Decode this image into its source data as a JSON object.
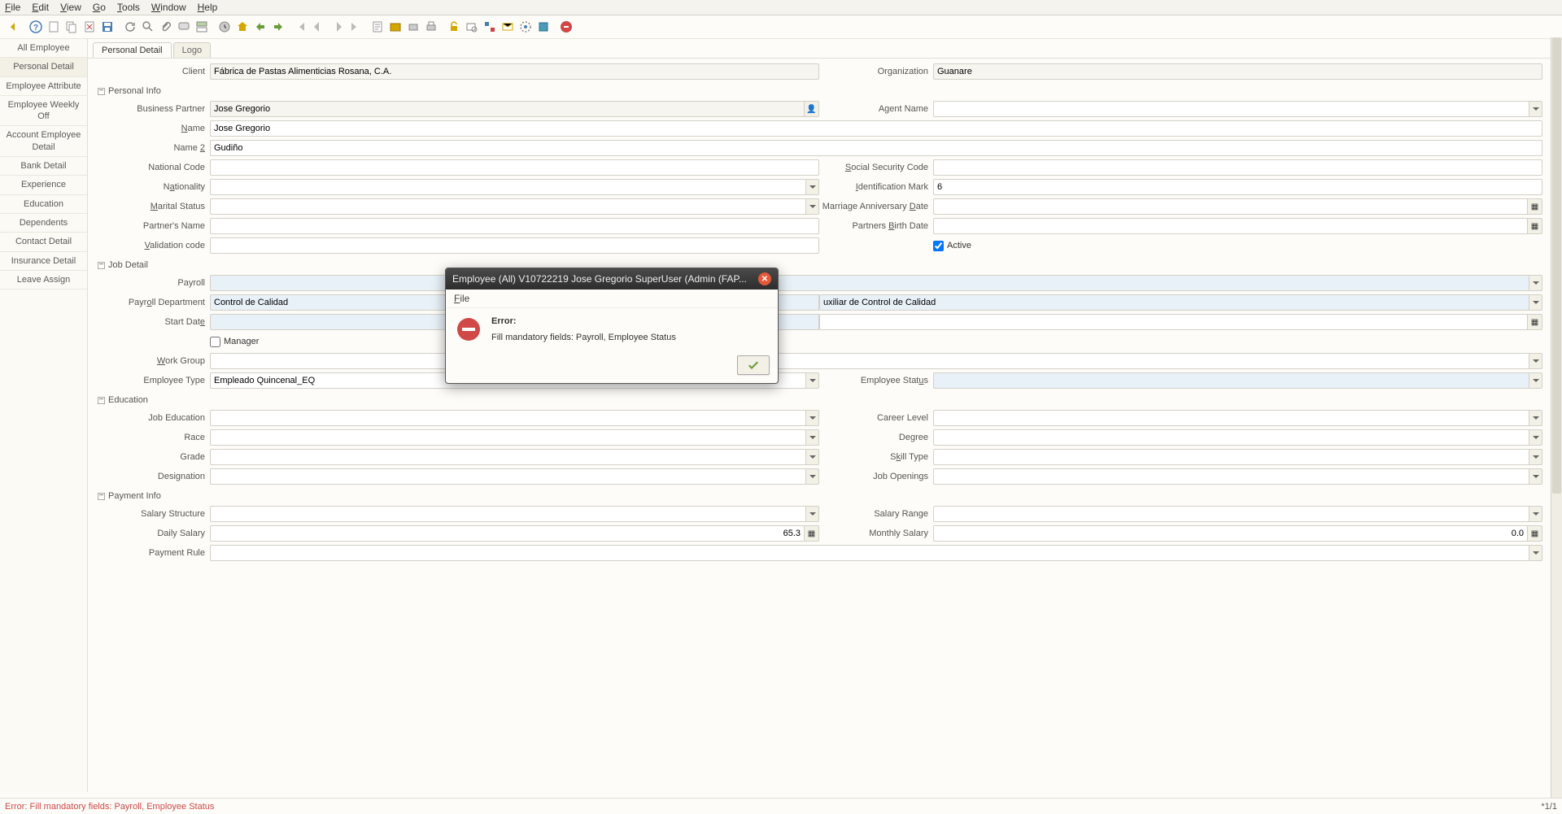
{
  "menu": {
    "file": "File",
    "edit": "Edit",
    "view": "View",
    "go": "Go",
    "tools": "Tools",
    "window": "Window",
    "help": "Help"
  },
  "sidebar": {
    "items": [
      {
        "label": "All Employee"
      },
      {
        "label": "Personal Detail"
      },
      {
        "label": "Employee Attribute"
      },
      {
        "label": "Employee Weekly Off"
      },
      {
        "label": "Account Employee Detail"
      },
      {
        "label": "Bank Detail"
      },
      {
        "label": "Experience"
      },
      {
        "label": "Education"
      },
      {
        "label": "Dependents"
      },
      {
        "label": "Contact Detail"
      },
      {
        "label": "Insurance Detail"
      },
      {
        "label": "Leave Assign"
      }
    ]
  },
  "tabs": {
    "personal": "Personal Detail",
    "logo": "Logo"
  },
  "top_row": {
    "client_lbl": "Client",
    "client_val": "Fábrica de Pastas Alimenticias Rosana, C.A.",
    "org_lbl": "Organization",
    "org_val": "Guanare"
  },
  "sections": {
    "personal": "Personal Info",
    "job": "Job Detail",
    "edu": "Education",
    "pay": "Payment Info"
  },
  "personal": {
    "bp_lbl": "Business Partner",
    "bp_val": "Jose Gregorio",
    "agent_lbl": "Agent Name",
    "agent_val": "",
    "name_lbl": "Name",
    "name_val": "Jose Gregorio",
    "name2_lbl": "Name 2",
    "name2_val": "Gudiño",
    "natcode_lbl": "National Code",
    "natcode_val": "",
    "ssc_lbl": "Social Security Code",
    "ssc_val": "",
    "nationality_lbl": "Nationality",
    "nationality_val": "",
    "idmark_lbl": "Identification Mark",
    "idmark_val": "6",
    "marital_lbl": "Marital Status",
    "marital_val": "",
    "marrdate_lbl": "Marriage Anniversary Date",
    "marrdate_val": "",
    "pname_lbl": "Partner's Name",
    "pname_val": "",
    "pbdate_lbl": "Partners Birth Date",
    "pbdate_val": "",
    "valcode_lbl": "Validation code",
    "valcode_val": "",
    "active_lbl": "Active"
  },
  "job": {
    "payroll_lbl": "Payroll",
    "payroll_val": "",
    "paydept_lbl": "Payroll Department",
    "paydept_val": "Control de Calidad",
    "jobrole_val": "uxiliar de Control de Calidad",
    "start_lbl": "Start Date",
    "start_val": "",
    "manager_lbl": "Manager",
    "workgroup_lbl": "Work Group",
    "workgroup_val": "",
    "emptype_lbl": "Employee Type",
    "emptype_val": "Empleado Quincenal_EQ",
    "empstatus_lbl": "Employee Status",
    "empstatus_val": ""
  },
  "edu": {
    "jedu_lbl": "Job Education",
    "jedu_val": "",
    "career_lbl": "Career Level",
    "career_val": "",
    "race_lbl": "Race",
    "race_val": "",
    "degree_lbl": "Degree",
    "degree_val": "",
    "grade_lbl": "Grade",
    "grade_val": "",
    "skill_lbl": "Skill Type",
    "skill_val": "",
    "desig_lbl": "Designation",
    "desig_val": "",
    "jobop_lbl": "Job Openings",
    "jobop_val": ""
  },
  "pay": {
    "salstr_lbl": "Salary Structure",
    "salstr_val": "",
    "salrange_lbl": "Salary Range",
    "salrange_val": "",
    "daily_lbl": "Daily Salary",
    "daily_val": "65.3",
    "monthly_lbl": "Monthly Salary",
    "monthly_val": "0.0",
    "payrule_lbl": "Payment Rule",
    "payrule_val": ""
  },
  "dialog": {
    "title": "Employee (All)  V10722219  Jose Gregorio  SuperUser (Admin (FAP...",
    "file": "File",
    "err_title": "Error:",
    "err_msg": "Fill mandatory fields: Payroll, Employee Status"
  },
  "status": {
    "err": "Error: Fill mandatory fields: Payroll, Employee Status",
    "right": "*1/1"
  }
}
